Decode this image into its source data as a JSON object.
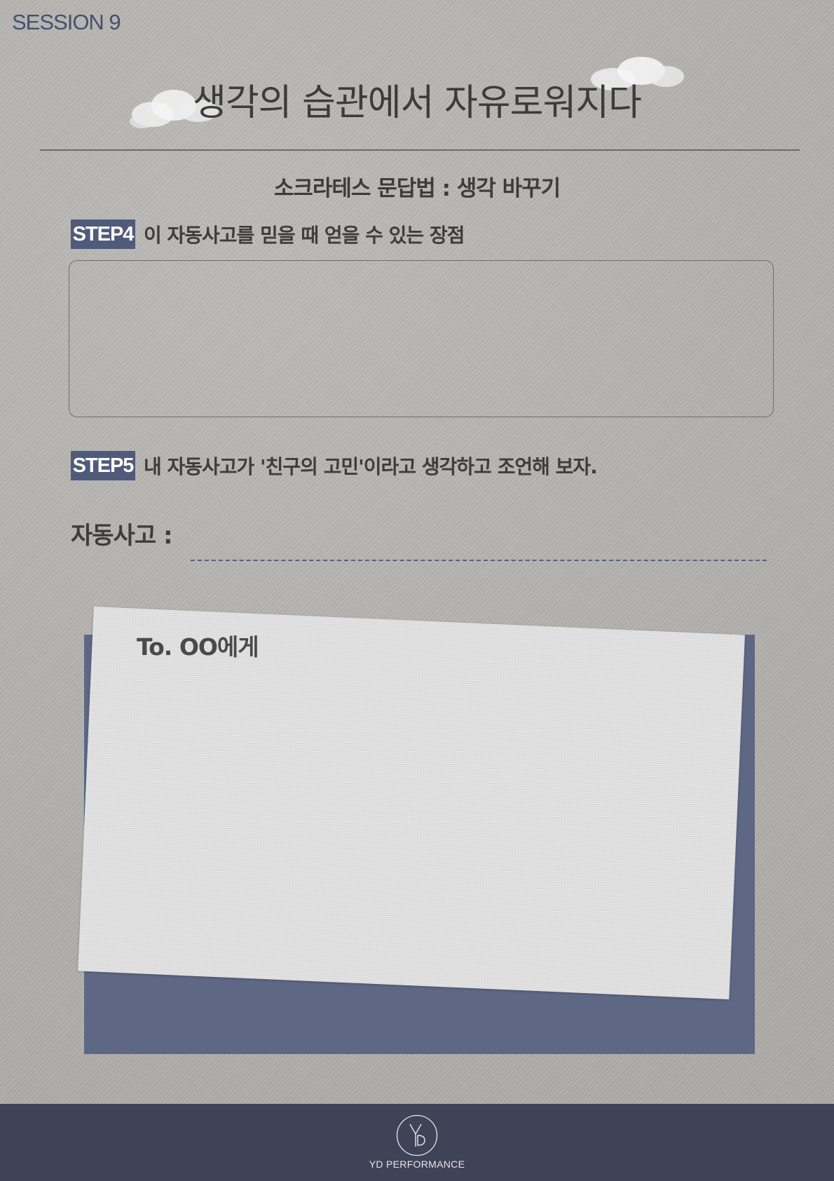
{
  "header": {
    "session": "SESSION 9",
    "title": "생각의 습관에서 자유로워지다",
    "subtitle": "소크라테스 문답법 : 생각 바꾸기"
  },
  "step4": {
    "badge": "STEP4",
    "text": "이 자동사고를 믿을 때 얻을 수 있는 장점"
  },
  "step5": {
    "badge": "STEP5",
    "text": "내 자동사고가 '친구의 고민'이라고 생각하고 조언해 보자."
  },
  "auto_thought": {
    "label": "자동사고 :"
  },
  "letter": {
    "to": "To. OO에게"
  },
  "footer": {
    "logo_icon": "yd-monogram-icon",
    "brand": "YD PERFORMANCE"
  },
  "colors": {
    "accent_navy": "#505a7a",
    "card_back": "#5e6885",
    "footer_bg": "#3e4358",
    "background": "#b3b2af"
  }
}
